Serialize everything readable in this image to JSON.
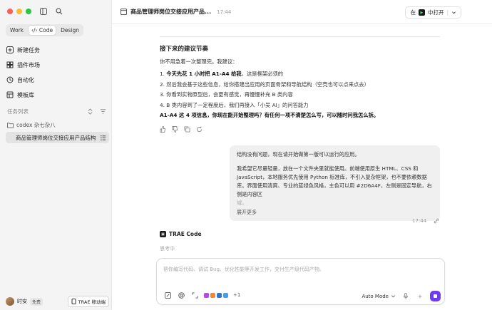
{
  "sidebar": {
    "mode_tabs": [
      {
        "label": "Work"
      },
      {
        "label": "Code",
        "active": true
      },
      {
        "label": "Design"
      }
    ],
    "nav": [
      {
        "label": "新建任务",
        "icon": "new-task-icon"
      },
      {
        "label": "插件市场",
        "icon": "plugin-market-icon"
      },
      {
        "label": "自动化",
        "icon": "automation-icon"
      },
      {
        "label": "模板库",
        "icon": "template-library-icon"
      }
    ],
    "task_list_title": "任务列表",
    "folder": "codex 杂七杂八",
    "task": "商品管理师岗位交接应用产品结构",
    "user": {
      "name": "时安",
      "plan": "免费"
    },
    "mobile_button": "TRAE 移动端"
  },
  "header": {
    "title": "商品管理师岗位交接应用产品...",
    "time": "17:44",
    "open_prefix": "在",
    "open_label": "中打开"
  },
  "content": {
    "heading": "接下来的建议节奏",
    "intro": "你不用急着一次整理完。我建议：",
    "steps": [
      {
        "num": "1.",
        "bold": "今天先花 1 小时把 A1-A4 给我",
        "rest": "，这是框架必须的"
      },
      {
        "num": "2.",
        "bold": "",
        "rest": "然后我会基于这些信息，给你搭建出应用的页面骨架和导航结构（空壳也可以点来点去）"
      },
      {
        "num": "3.",
        "bold": "",
        "rest": "你看到实物原型后，会更有感觉，再慢慢补充 B 类内容"
      },
      {
        "num": "4.",
        "bold": "",
        "rest": "B 类内容到了一定程度后，我们再接入「小吴 AI」的问答能力"
      }
    ],
    "question": "A1-A4 这 4 项信息，你现在能开始整理吗？有任何一项不清楚怎么写，可以随时问我怎么拆。"
  },
  "user_message": {
    "line1": "结构没有问题，现在请开始做第一版可以运行的应用。",
    "para2": "我希望它尽量轻量，放在一个文件夹里就能使用。前端使用原生 HTML、CSS 和 JavaScript，本地服务优先使用 Python 标准库，不引入复杂框架，也不要依赖数据库。界面使用清爽、专业的蓝绿色风格，主色可以用 #2D6A4F，左侧是固定导航，右侧是内容区",
    "fade": "域。",
    "more": "展开更多",
    "time": "17:44"
  },
  "agent": {
    "name": "TRAE Code",
    "status": "思考中"
  },
  "composer": {
    "placeholder": "帮你编写代码、调试 Bug、优化性能等开发工作，交付生产级代码产物。",
    "extra_count": "+1",
    "mode": "Auto Mode"
  },
  "colors": {
    "send": "#6c3df5",
    "sidebar_bg": "#f4f4f4",
    "bubble_bg": "#f0f0f0"
  }
}
